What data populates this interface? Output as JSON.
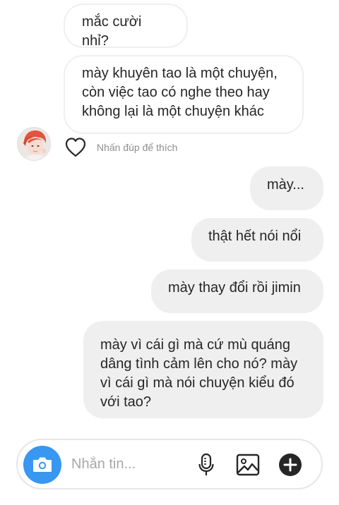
{
  "messages": [
    {
      "side": "in",
      "text": "mắc cười nhỉ?"
    },
    {
      "side": "in",
      "text": "mày khuyên tao là một chuyện,\ncòn việc tao có nghe theo hay\nkhông lại là một chuyện khác"
    },
    {
      "side": "out",
      "text": "mày..."
    },
    {
      "side": "out",
      "text": "thật hết nói nổi"
    },
    {
      "side": "out",
      "text": "mày thay đổi rồi jimin"
    },
    {
      "side": "out",
      "text": "mày vì cái gì mà cứ mù quáng\ndâng tình cảm lên cho nó? mày\nvì cái gì mà nói chuyện kiểu đó\nvới tao?"
    }
  ],
  "like_hint": "Nhấn đúp để thích",
  "composer": {
    "placeholder": "Nhắn tin...",
    "icons": [
      "camera-icon",
      "microphone-icon",
      "image-icon",
      "plus-icon"
    ],
    "camera_color": "#3897f0"
  },
  "colors": {
    "outgoing_bubble": "#efefef",
    "incoming_border": "#efefef",
    "hint_text": "#8e8e8e"
  }
}
